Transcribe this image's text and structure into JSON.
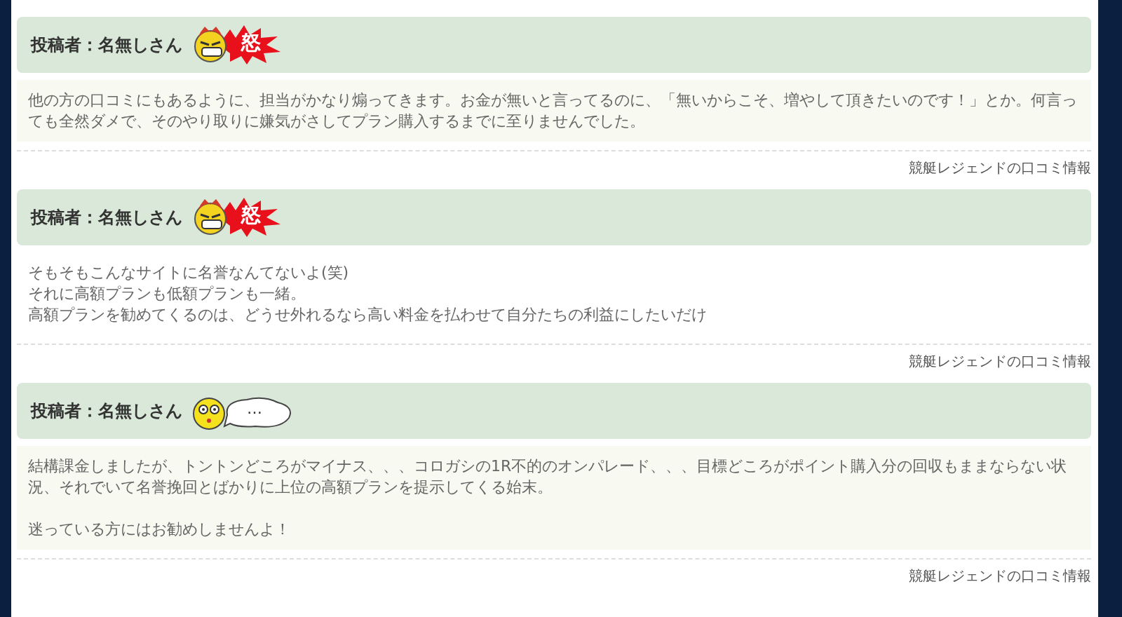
{
  "reviews": [
    {
      "author": "投稿者：名無しさん",
      "mood": {
        "kind": "angry",
        "label": "怒"
      },
      "shaded": true,
      "paragraphs": [
        [
          "他の方の口コミにもあるように、担当がかなり煽ってきます。お金が無いと言ってるのに、「無いからこそ、増やして頂きたいのです！」とか。何言っても全然ダメで、そのやり取りに嫌気がさしてプラン購入するまでに至りませんでした。"
        ]
      ],
      "source": "競艇レジェンドの口コミ情報"
    },
    {
      "author": "投稿者：名無しさん",
      "mood": {
        "kind": "angry",
        "label": "怒"
      },
      "shaded": false,
      "paragraphs": [
        [
          "そもそもこんなサイトに名誉なんてないよ(笑)",
          "それに高額プランも低額プランも一緒。",
          "高額プランを勧めてくるのは、どうせ外れるなら高い料金を払わせて自分たちの利益にしたいだけ"
        ]
      ],
      "source": "競艇レジェンドの口コミ情報"
    },
    {
      "author": "投稿者：名無しさん",
      "mood": {
        "kind": "puzzled",
        "label": "…"
      },
      "shaded": true,
      "paragraphs": [
        [
          "結構課金しましたが、トントンどころがマイナス、、、コロガシの1R不的のオンパレード、、、目標どころがポイント購入分の回収もままならない状況、それでいて名誉挽回とばかりに上位の高額プランを提示してくる始末。"
        ],
        [
          "迷っている方にはお勧めしませんよ！"
        ]
      ],
      "source": "競艇レジェンドの口コミ情報"
    }
  ]
}
